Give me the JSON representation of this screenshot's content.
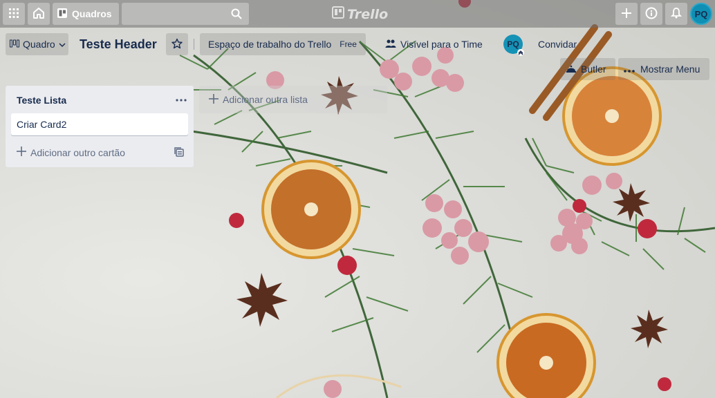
{
  "topbar": {
    "boards_label": "Quadros",
    "search_placeholder": "",
    "logo_text": "Trello",
    "avatar_initials": "PQ"
  },
  "board": {
    "view_label": "Quadro",
    "title": "Teste Header",
    "workspace_label": "Espaço de trabalho do Trello",
    "workspace_plan": "Free",
    "visibility_label": "Visível para o Time",
    "member_initials": "PQ",
    "invite_label": "Convidar",
    "butler_label": "Butler",
    "menu_label": "Mostrar Menu"
  },
  "lists": [
    {
      "title": "Teste Lista",
      "cards": [
        "Criar Card2"
      ],
      "add_card_label": "Adicionar outro cartão"
    }
  ],
  "add_list_label": "Adicionar outra lista",
  "colors": {
    "text": "#172b4d",
    "list_bg": "#ebecf0",
    "avatar": "#0f8fb4"
  }
}
